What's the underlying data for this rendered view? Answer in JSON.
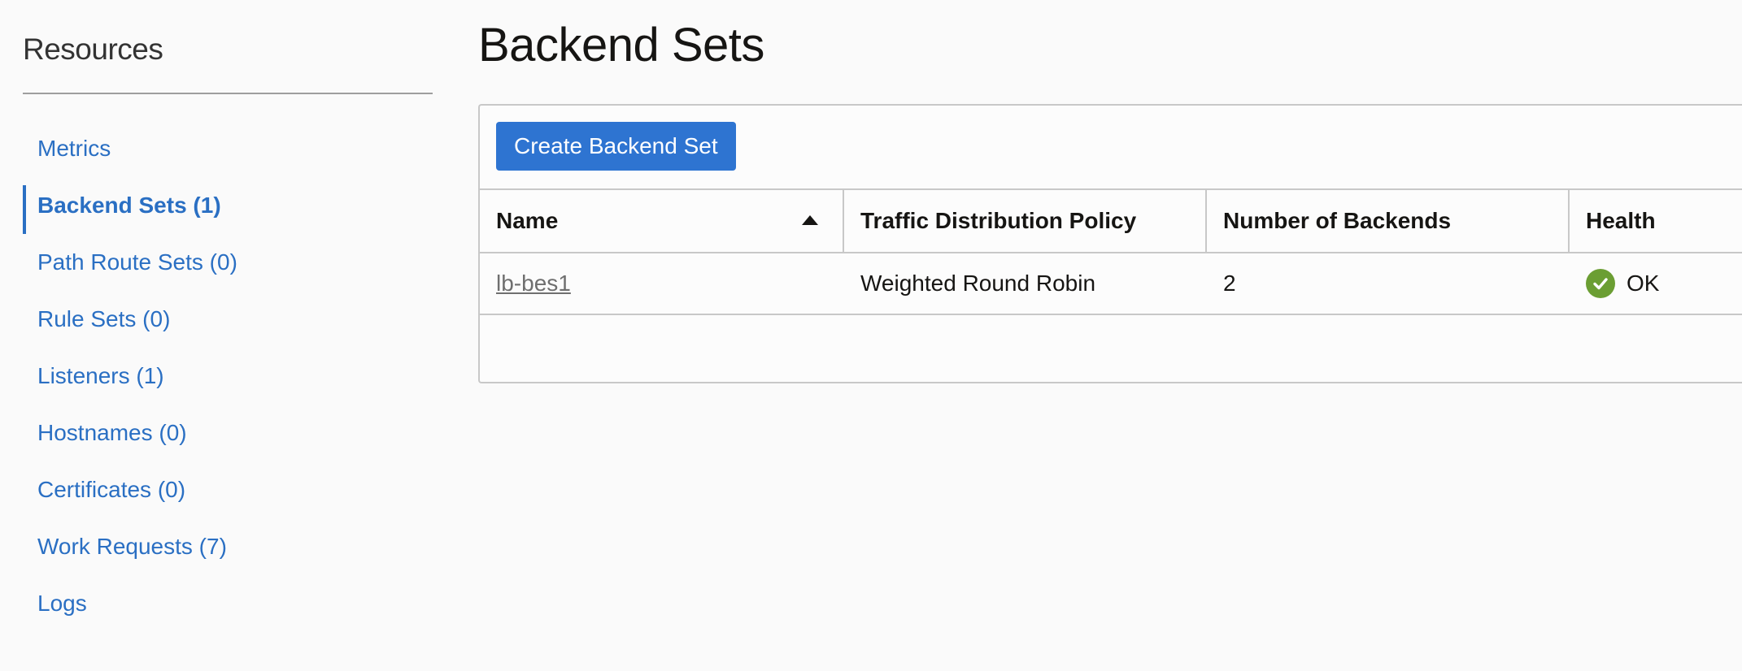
{
  "sidebar": {
    "title": "Resources",
    "items": [
      {
        "label": "Metrics"
      },
      {
        "label": "Backend Sets (1)",
        "active": true
      },
      {
        "label": "Path Route Sets (0)"
      },
      {
        "label": "Rule Sets (0)"
      },
      {
        "label": "Listeners (1)"
      },
      {
        "label": "Hostnames (0)"
      },
      {
        "label": "Certificates (0)"
      },
      {
        "label": "Work Requests (7)"
      },
      {
        "label": "Logs"
      }
    ]
  },
  "main": {
    "title": "Backend Sets",
    "create_button_label": "Create Backend Set",
    "table": {
      "columns": [
        {
          "label": "Name",
          "sort": "ascending"
        },
        {
          "label": "Traffic Distribution Policy"
        },
        {
          "label": "Number of Backends"
        },
        {
          "label": "Health"
        }
      ],
      "rows": [
        {
          "name": "lb-bes1",
          "policy": "Weighted Round Robin",
          "backends": "2",
          "health": "OK",
          "health_icon": "check-circle-icon",
          "health_color": "#6b9e33"
        }
      ]
    }
  },
  "colors": {
    "accent": "#2a6fc3",
    "button": "#2e74d1",
    "ok": "#6b9e33"
  }
}
